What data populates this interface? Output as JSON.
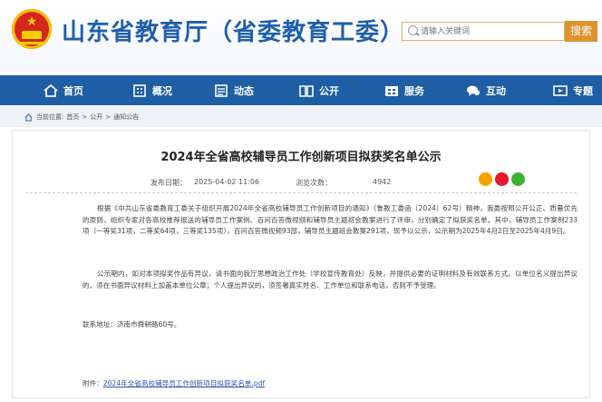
{
  "header": {
    "title": "山东省教育厅（省委教育工委）",
    "search_placeholder": "请输入关键词",
    "search_button": "搜索"
  },
  "nav": [
    {
      "label": "首页",
      "icon": "home-icon"
    },
    {
      "label": "概况",
      "icon": "building-icon"
    },
    {
      "label": "动态",
      "icon": "news-icon"
    },
    {
      "label": "公开",
      "icon": "book-icon"
    },
    {
      "label": "服务",
      "icon": "service-icon"
    },
    {
      "label": "互动",
      "icon": "chat-icon"
    },
    {
      "label": "专题",
      "icon": "topic-icon"
    }
  ],
  "breadcrumb": {
    "current_label": "当前位置:",
    "items": [
      "首页",
      "公开",
      "通知公告"
    ],
    "separator": ">"
  },
  "article": {
    "title": "2024年全省高校辅导员工作创新项目拟获奖名单公示",
    "publish_label": "发布日期：",
    "publish_date": "2025-04-02 11:06",
    "views_label": "浏览次数：",
    "views": "4942",
    "paragraphs": [
      "根据《中共山东省委教育工委关于组织开展2024年全省高校辅导员工作创新项目的通知》（鲁教工委函〔2024〕62号）精神，我委按照公开公正、质量优先的原则，组织专家对各高校推荐报送的辅导员工作案例、百问百答微视频和辅导员主题班会教案进行了评审，分别确定了拟获奖名单。其中，辅导员工作案例233项（一等奖31项，二等奖64项，三等奖135项），百问百答微视频93部，辅导员主题班会教案291项，现予以公示，公示期为2025年4月2日至2025年4月9日。",
      "公示期内，如对本项拟奖作品有异议，请书面向我厅思想政治工作处（学校宣传教育处）反映，并提供必要的证明材料及有效联系方式。以单位名义提出异议的，须在书面异议材料上加盖本单位公章；个人提出异议的，须签署真实姓名、工作单位和联系电话，否则不予受理。",
      "联系地址：济南市舜耕路60号。"
    ],
    "attachment_label": "附件：",
    "attachment_name": "2024年全省高校辅导员工作创新项目拟获奖名单.pdf"
  },
  "colors": {
    "nav_bg": "#1d5ea5",
    "title_blue": "#1f5faa",
    "search_orange": "#e0922f"
  }
}
